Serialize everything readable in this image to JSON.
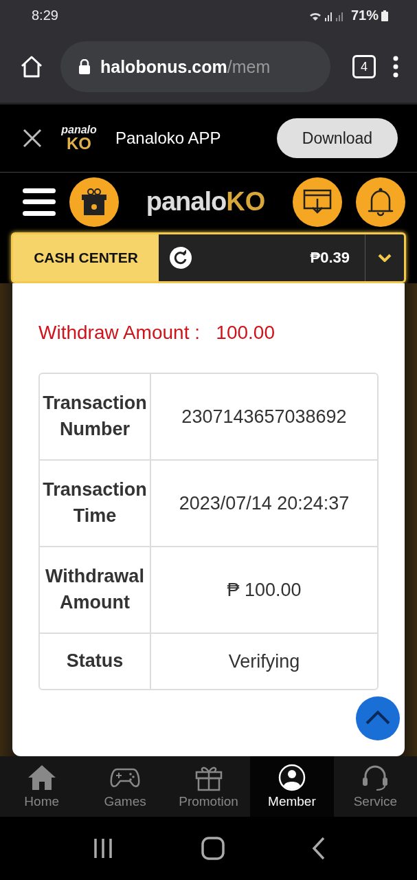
{
  "status_bar": {
    "time": "8:29",
    "battery": "71%"
  },
  "browser": {
    "url_host": "halobonus.com",
    "url_path": "/mem",
    "tab_count": "4"
  },
  "app_banner": {
    "logo_top": "panalo",
    "logo_bottom": "KO",
    "title": "Panaloko APP",
    "button": "Download"
  },
  "header": {
    "logo_text": "panalo",
    "logo_accent": "KO"
  },
  "cash_center": {
    "label": "CASH CENTER",
    "balance": "₱0.39"
  },
  "withdraw": {
    "label": "Withdraw Amount :",
    "amount": "100.00"
  },
  "details": [
    {
      "label": "Transaction Number",
      "value": "2307143657038692"
    },
    {
      "label": "Transaction Time",
      "value": "2023/07/14 20:24:37"
    },
    {
      "label": "Withdrawal Amount",
      "value": "₱ 100.00"
    },
    {
      "label": "Status",
      "value": "Verifying"
    }
  ],
  "bottom_nav": [
    {
      "label": "Home",
      "kind": "home",
      "selected": false
    },
    {
      "label": "Games",
      "kind": "games",
      "selected": false
    },
    {
      "label": "Promotion",
      "kind": "promotion",
      "selected": false
    },
    {
      "label": "Member",
      "kind": "member",
      "selected": true
    },
    {
      "label": "Service",
      "kind": "service",
      "selected": false
    }
  ]
}
